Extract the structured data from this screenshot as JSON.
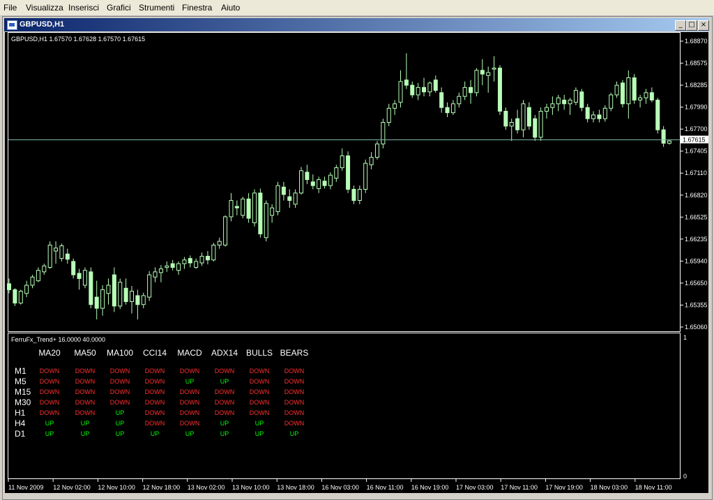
{
  "menu": [
    "File",
    "Visualizza",
    "Inserisci",
    "Grafici",
    "Strumenti",
    "Finestra",
    "Aiuto"
  ],
  "window": {
    "title": "GBPUSD,H1",
    "btn_min": "_",
    "btn_max": "□",
    "btn_close": "×"
  },
  "chart_data": {
    "type": "candlestick",
    "title": "GBPUSD,H1  1.67570 1.67628 1.67570 1.67615",
    "current_price": 1.67615,
    "current_price_label": "1.67615",
    "ylim": [
      1.6506,
      1.6898
    ],
    "y_ticks": [
      "1.68870",
      "1.68575",
      "1.68285",
      "1.67990",
      "1.67700",
      "1.67405",
      "1.67110",
      "1.66820",
      "1.66525",
      "1.66235",
      "1.65940",
      "1.65650",
      "1.65355",
      "1.65060"
    ],
    "x_ticks": [
      "11 Nov 2009",
      "12 Nov 02:00",
      "12 Nov 10:00",
      "12 Nov 18:00",
      "13 Nov 02:00",
      "13 Nov 10:00",
      "13 Nov 18:00",
      "16 Nov 03:00",
      "16 Nov 11:00",
      "16 Nov 19:00",
      "17 Nov 03:00",
      "17 Nov 11:00",
      "17 Nov 19:00",
      "18 Nov 03:00",
      "18 Nov 11:00"
    ],
    "candles": [
      [
        1.6568,
        1.6575,
        1.6555,
        1.656
      ],
      [
        1.656,
        1.6562,
        1.6538,
        1.6542
      ],
      [
        1.6542,
        1.656,
        1.654,
        1.6558
      ],
      [
        1.6555,
        1.6572,
        1.655,
        1.6566
      ],
      [
        1.6566,
        1.658,
        1.6562,
        1.6577
      ],
      [
        1.6572,
        1.659,
        1.657,
        1.6586
      ],
      [
        1.6584,
        1.6595,
        1.658,
        1.6592
      ],
      [
        1.659,
        1.6625,
        1.6588,
        1.662
      ],
      [
        1.6612,
        1.6625,
        1.6595,
        1.6616
      ],
      [
        1.6602,
        1.6622,
        1.6598,
        1.6619
      ],
      [
        1.6608,
        1.6615,
        1.6595,
        1.6601
      ],
      [
        1.6598,
        1.6602,
        1.6575,
        1.658
      ],
      [
        1.6582,
        1.6588,
        1.656,
        1.6575
      ],
      [
        1.6566,
        1.659,
        1.6562,
        1.6586
      ],
      [
        1.6584,
        1.659,
        1.6535,
        1.654
      ],
      [
        1.655,
        1.6572,
        1.652,
        1.6535
      ],
      [
        1.6535,
        1.6566,
        1.6525,
        1.656
      ],
      [
        1.6555,
        1.6575,
        1.654,
        1.6566
      ],
      [
        1.658,
        1.659,
        1.653,
        1.6538
      ],
      [
        1.6538,
        1.6575,
        1.6534,
        1.657
      ],
      [
        1.6562,
        1.6575,
        1.654,
        1.6544
      ],
      [
        1.6544,
        1.6565,
        1.6528,
        1.6558
      ],
      [
        1.6552,
        1.656,
        1.652,
        1.654
      ],
      [
        1.654,
        1.6556,
        1.6535,
        1.6552
      ],
      [
        1.655,
        1.6585,
        1.6545,
        1.658
      ],
      [
        1.6577,
        1.659,
        1.657,
        1.6584
      ],
      [
        1.6583,
        1.6593,
        1.657,
        1.6588
      ],
      [
        1.659,
        1.6598,
        1.6584,
        1.6592
      ],
      [
        1.6595,
        1.66,
        1.6586,
        1.659
      ],
      [
        1.6586,
        1.6598,
        1.658,
        1.6595
      ],
      [
        1.6595,
        1.6604,
        1.6588,
        1.66
      ],
      [
        1.6602,
        1.6606,
        1.659,
        1.6596
      ],
      [
        1.659,
        1.6602,
        1.6588,
        1.6598
      ],
      [
        1.6596,
        1.661,
        1.6592,
        1.6605
      ],
      [
        1.6605,
        1.6612,
        1.6594,
        1.66
      ],
      [
        1.66,
        1.6623,
        1.6598,
        1.662
      ],
      [
        1.662,
        1.663,
        1.6615,
        1.6625
      ],
      [
        1.662,
        1.666,
        1.6618,
        1.6658
      ],
      [
        1.6658,
        1.669,
        1.6652,
        1.668
      ],
      [
        1.6672,
        1.668,
        1.666,
        1.667
      ],
      [
        1.666,
        1.6685,
        1.6656,
        1.6682
      ],
      [
        1.6682,
        1.669,
        1.665,
        1.6656
      ],
      [
        1.665,
        1.6695,
        1.6645,
        1.669
      ],
      [
        1.669,
        1.6696,
        1.663,
        1.6635
      ],
      [
        1.663,
        1.668,
        1.6625,
        1.6676
      ],
      [
        1.666,
        1.6675,
        1.665,
        1.667
      ],
      [
        1.6665,
        1.6705,
        1.666,
        1.67
      ],
      [
        1.6698,
        1.6705,
        1.668,
        1.6688
      ],
      [
        1.6685,
        1.6695,
        1.667,
        1.668
      ],
      [
        1.6675,
        1.6695,
        1.667,
        1.669
      ],
      [
        1.669,
        1.6725,
        1.6688,
        1.672
      ],
      [
        1.6718,
        1.6728,
        1.6702,
        1.6708
      ],
      [
        1.6705,
        1.6715,
        1.6695,
        1.67
      ],
      [
        1.6696,
        1.6712,
        1.669,
        1.6708
      ],
      [
        1.6706,
        1.6712,
        1.6696,
        1.67
      ],
      [
        1.67,
        1.6718,
        1.6695,
        1.6714
      ],
      [
        1.671,
        1.6728,
        1.6705,
        1.6724
      ],
      [
        1.6724,
        1.675,
        1.672,
        1.674
      ],
      [
        1.674,
        1.6746,
        1.669,
        1.6695
      ],
      [
        1.6695,
        1.67,
        1.6675,
        1.668
      ],
      [
        1.668,
        1.67,
        1.6675,
        1.6695
      ],
      [
        1.6695,
        1.6735,
        1.669,
        1.673
      ],
      [
        1.6728,
        1.6745,
        1.6722,
        1.6738
      ],
      [
        1.6738,
        1.676,
        1.6735,
        1.6756
      ],
      [
        1.6756,
        1.679,
        1.675,
        1.6785
      ],
      [
        1.6785,
        1.681,
        1.678,
        1.6804
      ],
      [
        1.6804,
        1.6815,
        1.6795,
        1.681
      ],
      [
        1.6812,
        1.6855,
        1.6805,
        1.684
      ],
      [
        1.6842,
        1.6878,
        1.683,
        1.6835
      ],
      [
        1.6835,
        1.684,
        1.6818,
        1.6822
      ],
      [
        1.6822,
        1.6838,
        1.6815,
        1.6832
      ],
      [
        1.6832,
        1.6845,
        1.682,
        1.6826
      ],
      [
        1.6826,
        1.684,
        1.682,
        1.6838
      ],
      [
        1.6842,
        1.6848,
        1.6825,
        1.6828
      ],
      [
        1.6825,
        1.6832,
        1.6798,
        1.6805
      ],
      [
        1.6805,
        1.6812,
        1.6792,
        1.6798
      ],
      [
        1.6798,
        1.6815,
        1.6795,
        1.681
      ],
      [
        1.681,
        1.6825,
        1.6805,
        1.682
      ],
      [
        1.682,
        1.684,
        1.6815,
        1.6832
      ],
      [
        1.6832,
        1.6842,
        1.681,
        1.6825
      ],
      [
        1.6825,
        1.6858,
        1.682,
        1.6855
      ],
      [
        1.6855,
        1.687,
        1.6835,
        1.685
      ],
      [
        1.6848,
        1.686,
        1.6825,
        1.6852
      ],
      [
        1.6858,
        1.6874,
        1.684,
        1.6858
      ],
      [
        1.6858,
        1.6862,
        1.6795,
        1.68
      ],
      [
        1.68,
        1.6805,
        1.6775,
        1.678
      ],
      [
        1.678,
        1.679,
        1.676,
        1.6785
      ],
      [
        1.679,
        1.6802,
        1.677,
        1.6775
      ],
      [
        1.6775,
        1.6815,
        1.6765,
        1.681
      ],
      [
        1.6805,
        1.6812,
        1.6775,
        1.678
      ],
      [
        1.679,
        1.6795,
        1.676,
        1.6765
      ],
      [
        1.6765,
        1.6805,
        1.676,
        1.68
      ],
      [
        1.68,
        1.681,
        1.679,
        1.6805
      ],
      [
        1.6805,
        1.682,
        1.6795,
        1.681
      ],
      [
        1.681,
        1.6822,
        1.68,
        1.6818
      ],
      [
        1.6815,
        1.6822,
        1.6802,
        1.681
      ],
      [
        1.681,
        1.6818,
        1.6795,
        1.6815
      ],
      [
        1.6812,
        1.6832,
        1.6808,
        1.6828
      ],
      [
        1.6826,
        1.683,
        1.68,
        1.6805
      ],
      [
        1.6805,
        1.681,
        1.6785,
        1.679
      ],
      [
        1.679,
        1.68,
        1.6785,
        1.6795
      ],
      [
        1.6795,
        1.6802,
        1.6785,
        1.679
      ],
      [
        1.679,
        1.6808,
        1.6786,
        1.6804
      ],
      [
        1.6804,
        1.6825,
        1.68,
        1.6822
      ],
      [
        1.6822,
        1.684,
        1.6818,
        1.6835
      ],
      [
        1.6838,
        1.6842,
        1.6805,
        1.681
      ],
      [
        1.681,
        1.6855,
        1.679,
        1.6845
      ],
      [
        1.6845,
        1.685,
        1.681,
        1.6815
      ],
      [
        1.6815,
        1.6822,
        1.6805,
        1.6818
      ],
      [
        1.6818,
        1.683,
        1.681,
        1.6825
      ],
      [
        1.6825,
        1.6832,
        1.6812,
        1.6815
      ],
      [
        1.6815,
        1.6818,
        1.677,
        1.6775
      ],
      [
        1.6775,
        1.678,
        1.6752,
        1.6757
      ],
      [
        1.6757,
        1.6762,
        1.6755,
        1.676
      ]
    ]
  },
  "indicator": {
    "label": "FerruFx_Trend+ 16.0000 40.0000",
    "scale_top": "1",
    "scale_bottom": "0",
    "columns": [
      "MA20",
      "MA50",
      "MA100",
      "CCI14",
      "MACD",
      "ADX14",
      "BULLS",
      "BEARS"
    ],
    "rows": [
      {
        "tf": "M1",
        "values": [
          "DOWN",
          "DOWN",
          "DOWN",
          "DOWN",
          "DOWN",
          "DOWN",
          "DOWN",
          "DOWN"
        ]
      },
      {
        "tf": "M5",
        "values": [
          "DOWN",
          "DOWN",
          "DOWN",
          "DOWN",
          "UP",
          "UP",
          "DOWN",
          "DOWN"
        ]
      },
      {
        "tf": "M15",
        "values": [
          "DOWN",
          "DOWN",
          "DOWN",
          "DOWN",
          "DOWN",
          "DOWN",
          "DOWN",
          "DOWN"
        ]
      },
      {
        "tf": "M30",
        "values": [
          "DOWN",
          "DOWN",
          "DOWN",
          "DOWN",
          "DOWN",
          "DOWN",
          "DOWN",
          "DOWN"
        ]
      },
      {
        "tf": "H1",
        "values": [
          "DOWN",
          "DOWN",
          "UP",
          "DOWN",
          "DOWN",
          "DOWN",
          "DOWN",
          "DOWN"
        ]
      },
      {
        "tf": "H4",
        "values": [
          "UP",
          "UP",
          "UP",
          "DOWN",
          "DOWN",
          "UP",
          "UP",
          "DOWN"
        ]
      },
      {
        "tf": "D1",
        "values": [
          "UP",
          "UP",
          "UP",
          "UP",
          "UP",
          "UP",
          "UP",
          "UP"
        ]
      }
    ],
    "up_color": "#00ff00",
    "down_color": "#ff3030"
  },
  "colors": {
    "candle": "#b8ffb8",
    "grid": "#ffffff",
    "price_line": "#7fb8a8"
  }
}
